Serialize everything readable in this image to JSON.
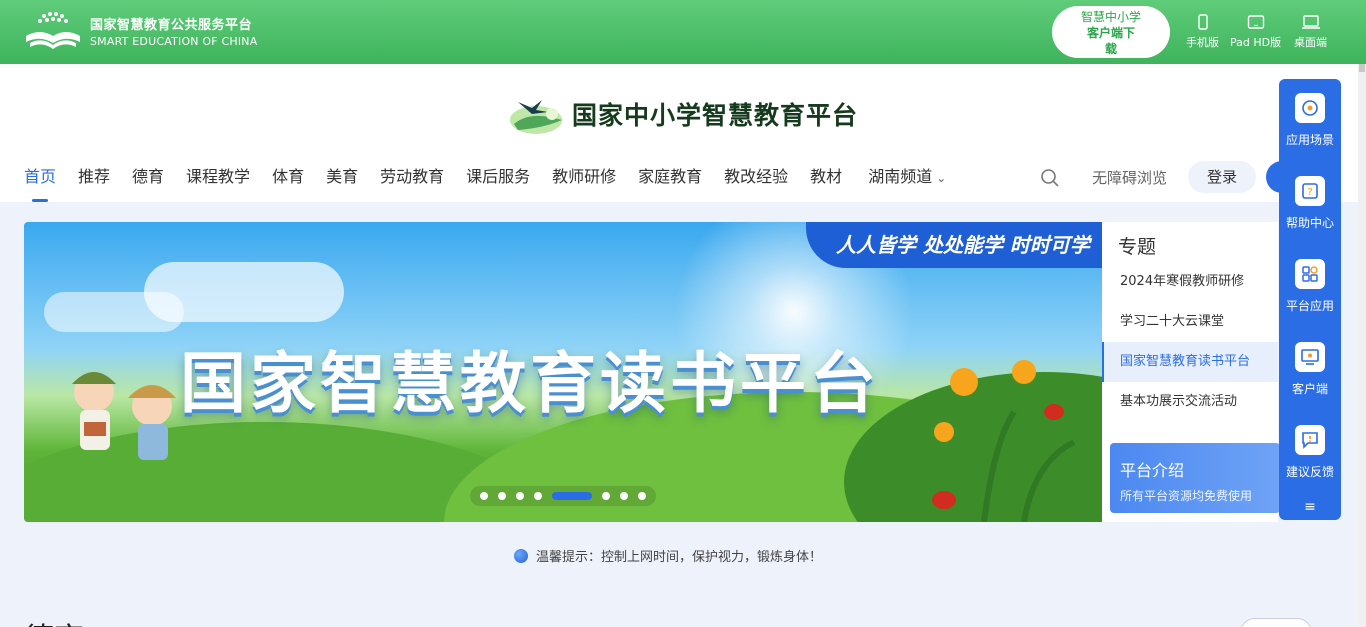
{
  "platform": {
    "name_cn": "国家智慧教育公共服务平台",
    "name_en": "SMART EDUCATION OF CHINA"
  },
  "client_download": {
    "line1": "智慧中小学",
    "line2": "客户端下",
    "line3": "载"
  },
  "devices": [
    {
      "label": "手机版",
      "icon": "phone-icon"
    },
    {
      "label": "Pad HD版",
      "icon": "tablet-icon"
    },
    {
      "label": "桌面端",
      "icon": "laptop-icon"
    }
  ],
  "site_title": "国家中小学智慧教育平台",
  "nav": [
    {
      "label": "首页",
      "active": true
    },
    {
      "label": "推荐"
    },
    {
      "label": "德育"
    },
    {
      "label": "课程教学"
    },
    {
      "label": "体育"
    },
    {
      "label": "美育"
    },
    {
      "label": "劳动教育"
    },
    {
      "label": "课后服务"
    },
    {
      "label": "教师研修"
    },
    {
      "label": "家庭教育"
    },
    {
      "label": "教改经验"
    },
    {
      "label": "教材"
    },
    {
      "label": "湖南频道",
      "dropdown": true
    }
  ],
  "header_actions": {
    "accessibility": "无障碍浏览",
    "login": "登录"
  },
  "banner": {
    "slogan": "人人皆学 处处能学 时时可学",
    "headline": "国家智慧教育读书平台",
    "slide_count": 9,
    "active_slide": 5
  },
  "topics": {
    "title": "专题",
    "items": [
      {
        "label": "2024年寒假教师研修"
      },
      {
        "label": "学习二十大云课堂"
      },
      {
        "label": "国家智慧教育读书平台",
        "active": true
      },
      {
        "label": "基本功展示交流活动"
      }
    ],
    "intro_title": "平台介绍",
    "intro_sub": "所有平台资源均免费使用"
  },
  "sidebar": [
    {
      "label": "应用场景",
      "icon": "scene-icon"
    },
    {
      "label": "帮助中心",
      "icon": "help-icon"
    },
    {
      "label": "平台应用",
      "icon": "apps-icon"
    },
    {
      "label": "客户端",
      "icon": "client-icon"
    },
    {
      "label": "建议反馈",
      "icon": "feedback-icon"
    }
  ],
  "tip": "温馨提示：控制上网时间，保护视力，锻炼身体！",
  "section_title": "德育",
  "colors": {
    "green": "#3fb35c",
    "blue": "#2b6de5",
    "bg": "#eef2fb"
  }
}
